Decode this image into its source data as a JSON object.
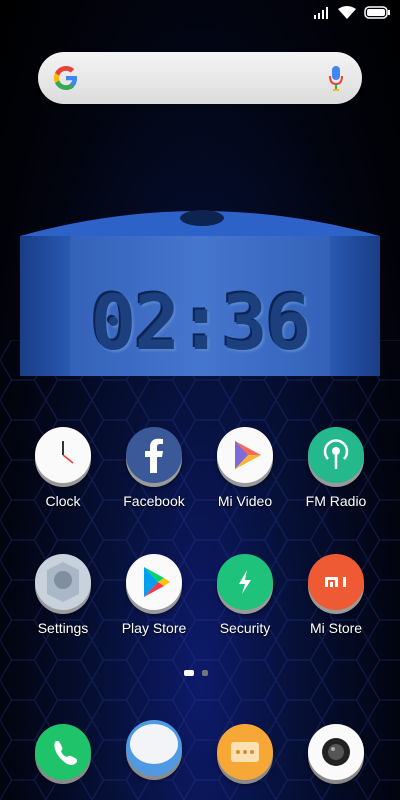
{
  "status_bar": {
    "icons": [
      "signal-icon",
      "wifi-icon",
      "battery-icon"
    ]
  },
  "search": {
    "logo": "google-logo-icon",
    "mic": "microphone-icon"
  },
  "clock_widget": {
    "time": "02:36"
  },
  "apps": [
    {
      "label": "Clock",
      "icon": "clock-icon"
    },
    {
      "label": "Facebook",
      "icon": "facebook-icon"
    },
    {
      "label": "Mi Video",
      "icon": "mi-video-icon"
    },
    {
      "label": "FM Radio",
      "icon": "fm-radio-icon"
    },
    {
      "label": "Settings",
      "icon": "settings-icon"
    },
    {
      "label": "Play Store",
      "icon": "play-store-icon"
    },
    {
      "label": "Security",
      "icon": "security-icon"
    },
    {
      "label": "Mi Store",
      "icon": "mi-store-icon"
    }
  ],
  "page_indicator": {
    "pages": 2,
    "active": 1
  },
  "dock": [
    {
      "icon": "phone-icon"
    },
    {
      "icon": "messages-icon"
    },
    {
      "icon": "apps-folder-icon"
    },
    {
      "icon": "camera-icon"
    }
  ],
  "colors": {
    "accent_blue": "#2b62c4",
    "facebook": "#3b5998",
    "security_green": "#1fc27a",
    "fm_teal": "#25b88c",
    "mi_orange": "#ee5a34"
  }
}
